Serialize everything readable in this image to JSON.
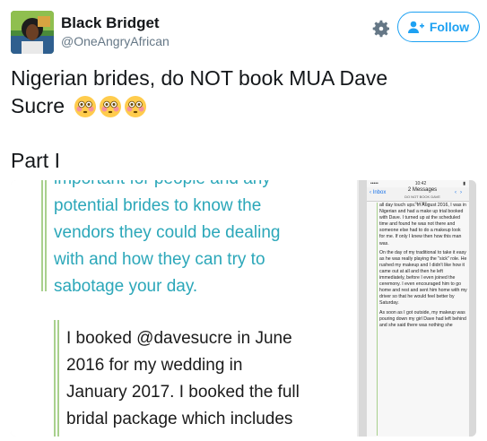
{
  "header": {
    "name": "Black Bridget",
    "handle": "@OneAngryAfrican",
    "follow_label": "Follow"
  },
  "icons": {
    "settings": "gear-icon",
    "follow": "add-user-icon",
    "emoji": "flushed-face-emoji"
  },
  "tweet": {
    "line1": "Nigerian brides, do NOT book MUA Dave",
    "line2": "Sucre",
    "part": "Part I"
  },
  "media_left": {
    "quote_a": [
      "important for people and any",
      "potential brides to know the",
      "vendors they could be dealing",
      "with and how they can try to",
      "sabotage your day."
    ],
    "quote_b": [
      "I booked @davesucre in June",
      "2016 for my wedding in",
      "January 2017. I booked the full",
      "bridal package which includes"
    ]
  },
  "media_right": {
    "carrier": "••••• ",
    "time": "10:42",
    "inbox_label": "Inbox",
    "messages_title": "2 Messages",
    "messages_subtitle": "DO NOT BOOK DAVE SUCRE...",
    "paragraphs": [
      "all day touch ups. In August 2016, I was in Nigerian and had a make up trial booked with Dave. I turned up at the scheduled time and found he was not there and someone else had to do a makeup look for me. If only I knew then how this man was.",
      "On the day of my traditional to take it easy as he was really playing the \"sick\" role. He rushed my makeup and I didn't like how it came out at all and then he left immediately, before I even joined the ceremony. I even encouraged him to go home and rest and sent him home with my driver so that he would feel better by Saturday.",
      "As soon as I got outside, my makeup was pouring down my girl Dave had left behind and she said there was nothing she"
    ]
  },
  "colors": {
    "accent": "#1da1f2",
    "quote_teal": "#2ba7b9",
    "quote_bar": "#a8d08d"
  }
}
